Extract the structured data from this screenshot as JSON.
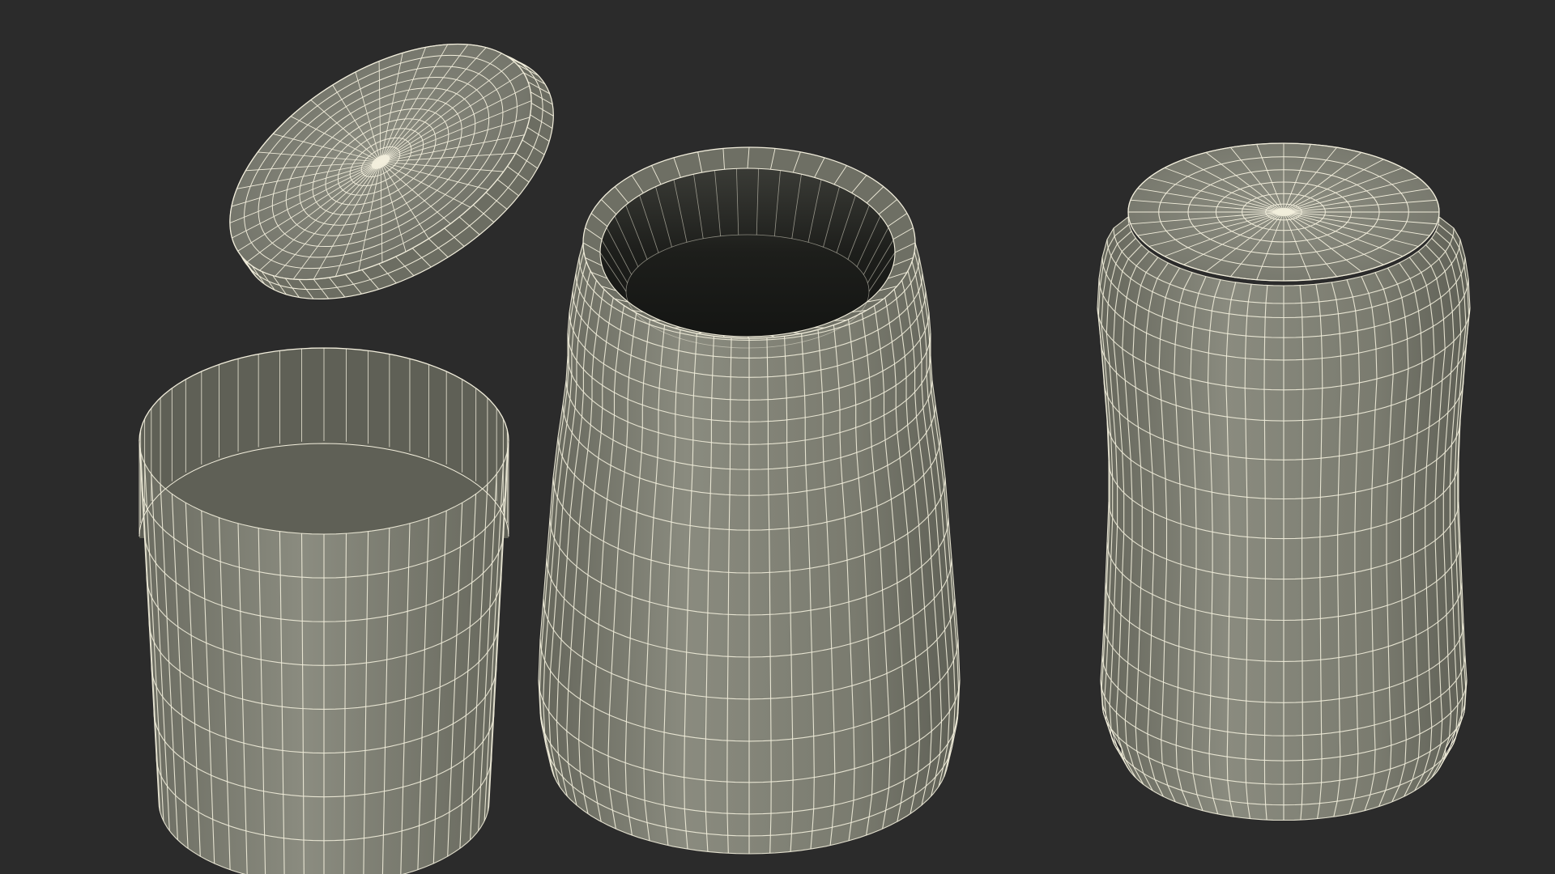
{
  "colors": {
    "background": "#2b2b2b",
    "surface_light": "#8a8b7e",
    "surface_mid": "#77786c",
    "surface_dark": "#5c5d53",
    "wire": "#f2eedc",
    "interior": "#1e1f1c"
  },
  "objects": [
    {
      "name": "jar-lid",
      "shape": "disc"
    },
    {
      "name": "label-sleeve",
      "shape": "open-cylinder"
    },
    {
      "name": "open-jar",
      "shape": "jar-open-top"
    },
    {
      "name": "inverted-jar",
      "shape": "jar-closed-top"
    }
  ]
}
